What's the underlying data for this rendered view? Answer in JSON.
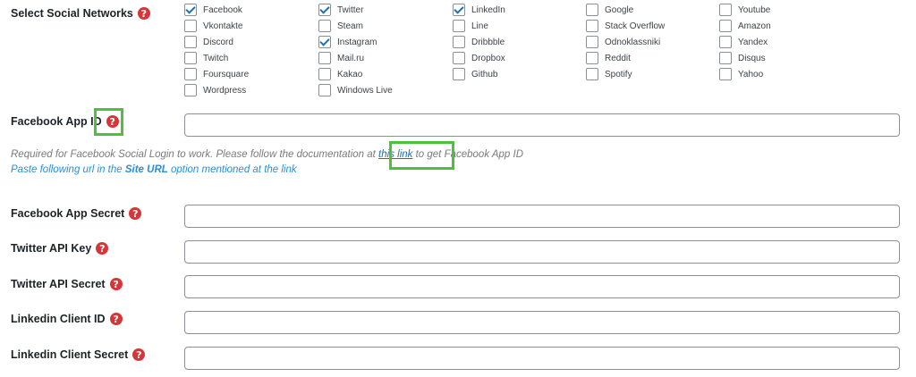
{
  "select_networks": {
    "label": "Select Social Networks",
    "columns": [
      [
        {
          "name": "Facebook",
          "checked": true
        },
        {
          "name": "Vkontakte",
          "checked": false
        },
        {
          "name": "Discord",
          "checked": false
        },
        {
          "name": "Twitch",
          "checked": false
        },
        {
          "name": "Foursquare",
          "checked": false
        },
        {
          "name": "Wordpress",
          "checked": false
        }
      ],
      [
        {
          "name": "Twitter",
          "checked": true
        },
        {
          "name": "Steam",
          "checked": false
        },
        {
          "name": "Instagram",
          "checked": true
        },
        {
          "name": "Mail.ru",
          "checked": false
        },
        {
          "name": "Kakao",
          "checked": false
        },
        {
          "name": "Windows Live",
          "checked": false
        }
      ],
      [
        {
          "name": "LinkedIn",
          "checked": true
        },
        {
          "name": "Line",
          "checked": false
        },
        {
          "name": "Dribbble",
          "checked": false
        },
        {
          "name": "Dropbox",
          "checked": false
        },
        {
          "name": "Github",
          "checked": false
        }
      ],
      [
        {
          "name": "Google",
          "checked": false
        },
        {
          "name": "Stack Overflow",
          "checked": false
        },
        {
          "name": "Odnoklassniki",
          "checked": false
        },
        {
          "name": "Reddit",
          "checked": false
        },
        {
          "name": "Spotify",
          "checked": false
        }
      ],
      [
        {
          "name": "Youtube",
          "checked": false
        },
        {
          "name": "Amazon",
          "checked": false
        },
        {
          "name": "Yandex",
          "checked": false
        },
        {
          "name": "Disqus",
          "checked": false
        },
        {
          "name": "Yahoo",
          "checked": false
        }
      ]
    ]
  },
  "help_glyph": "?",
  "fields": {
    "facebook_app_id": {
      "label": "Facebook App ID",
      "value": ""
    },
    "facebook_app_secret": {
      "label": "Facebook App Secret",
      "value": ""
    },
    "twitter_api_key": {
      "label": "Twitter API Key",
      "value": ""
    },
    "twitter_api_secret": {
      "label": "Twitter API Secret",
      "value": ""
    },
    "linkedin_client_id": {
      "label": "Linkedin Client ID",
      "value": ""
    },
    "linkedin_client_secret": {
      "label": "Linkedin Client Secret",
      "value": ""
    }
  },
  "facebook_help": {
    "before_link": "Required for Facebook Social Login to work. Please follow the documentation at ",
    "link_text": "this link",
    "after_link": " to get Facebook App ID",
    "site_url_before": "Paste following url in the ",
    "site_url_bold": "Site URL",
    "site_url_after": " option mentioned at the link"
  },
  "colors": {
    "help_icon": "#d63638",
    "highlight": "#4cc23c",
    "checkmark": "#2271b1",
    "link": "#2271b1",
    "info_text": "#2a8fd6"
  }
}
